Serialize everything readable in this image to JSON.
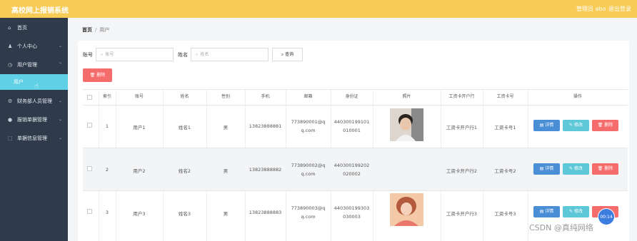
{
  "header": {
    "title": "高校网上报销系统",
    "user_label": "管理员 abo",
    "logout_label": "退出登录"
  },
  "sidebar": {
    "items": [
      {
        "label": "首页",
        "icon": "home-icon"
      },
      {
        "label": "个人中心",
        "icon": "person-icon"
      },
      {
        "label": "用户管理",
        "icon": "clock-icon"
      },
      {
        "label": "财务部人员管理",
        "icon": "gear-icon"
      },
      {
        "label": "报销单据管理",
        "icon": "pin-icon"
      },
      {
        "label": "单据信息管理",
        "icon": "dashed-square-icon"
      }
    ],
    "active_sub": "用户"
  },
  "breadcrumb": {
    "home": "首页",
    "separator": "/",
    "current": "用户"
  },
  "search": {
    "account_label": "账号",
    "account_placeholder": "账号",
    "name_label": "姓名",
    "name_placeholder": "姓名",
    "button_label": "查询"
  },
  "toolbar": {
    "delete_label": "删除"
  },
  "table": {
    "headers": [
      "索引",
      "账号",
      "姓名",
      "性别",
      "手机",
      "邮箱",
      "身份证",
      "照片",
      "工资卡开户行",
      "工资卡号",
      "操作"
    ],
    "rows": [
      {
        "index": "1",
        "account": "用户1",
        "name": "姓名1",
        "gender": "男",
        "phone": "13823888881",
        "email_a": "773890001@q",
        "email_b": "q.com",
        "id_a": "440300199101",
        "id_b": "010001",
        "photo": "young-man-photo",
        "bank": "工资卡开户行1",
        "card": "工资卡号1"
      },
      {
        "index": "2",
        "account": "用户2",
        "name": "姓名2",
        "gender": "男",
        "phone": "13823888882",
        "email_a": "773890002@q",
        "email_b": "q.com",
        "id_a": "440300199202",
        "id_b": "020002",
        "photo": "",
        "bank": "工资卡开户行2",
        "card": "工资卡号2"
      },
      {
        "index": "3",
        "account": "用户3",
        "name": "姓名3",
        "gender": "男",
        "phone": "13823888883",
        "email_a": "773890003@q",
        "email_b": "q.com",
        "id_a": "440300199303",
        "id_b": "030003",
        "photo": "young-woman-photo",
        "bank": "工资卡开户行3",
        "card": "工资卡号3"
      }
    ],
    "actions": {
      "detail": "详情",
      "edit": "修改",
      "delete": "删除"
    }
  },
  "timer": "00:14",
  "watermark": "CSDN @真纯网络",
  "colors": {
    "header": "#f7cb55",
    "sidebar": "#2f3b4a",
    "active_sub": "#5fd0e6",
    "delete": "#f56c6c",
    "detail": "#4a8fd6",
    "edit": "#5fc8d8"
  }
}
